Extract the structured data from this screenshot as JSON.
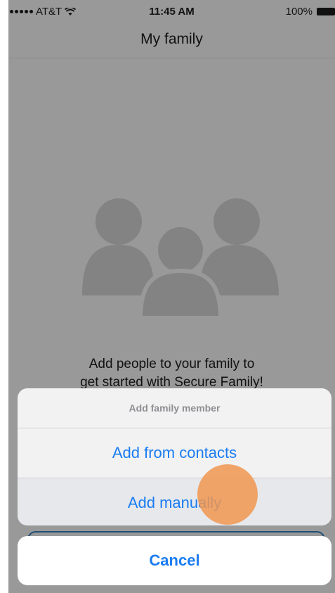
{
  "status_bar": {
    "carrier": "AT&T",
    "time": "11:45 AM",
    "battery": "100%"
  },
  "nav": {
    "title": "My family"
  },
  "empty_state": {
    "line1": "Add people to your family to",
    "line2": "get started with Secure Family!"
  },
  "action_sheet": {
    "title": "Add family member",
    "options": [
      {
        "label": "Add from contacts"
      },
      {
        "label": "Add manually"
      }
    ],
    "cancel_label": "Cancel"
  },
  "colors": {
    "accent": "#1a7cf2",
    "overlay_background": "#999999",
    "touch_indicator": "#f0964f"
  }
}
